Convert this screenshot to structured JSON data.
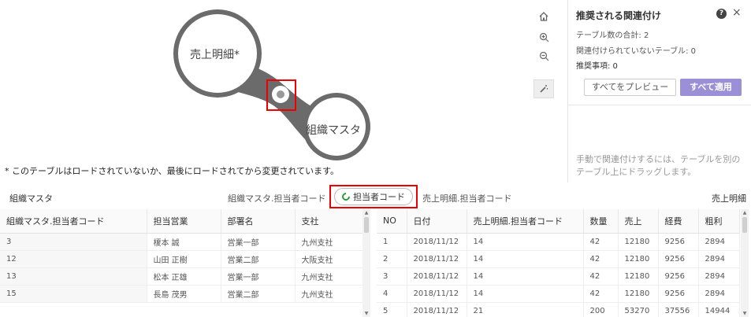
{
  "canvas": {
    "tables": [
      {
        "name": "売上明細*"
      },
      {
        "name": "組織マスタ"
      }
    ],
    "note": "* このテーブルはロードされていないか、最後にロードされてから変更されています。",
    "tools": [
      "home-icon",
      "zoom-in-icon",
      "zoom-out-icon",
      "magic-wand-icon"
    ]
  },
  "panel": {
    "title": "推奨される関連付け",
    "stats": {
      "total": "テーブル数の合計: 2",
      "unlinked": "関連付けられていないテーブル: 0",
      "recommended": "推奨事項: 0"
    },
    "preview_all": "すべてをプレビュー",
    "apply_all": "すべて適用",
    "hint": "手動で関連付けするには、テーブルを別のテーブル上にドラッグします。"
  },
  "join": {
    "left_table": "組織マスタ",
    "left_field": "組織マスタ.担当者コード",
    "key": "担当者コード",
    "right_field": "売上明細.担当者コード",
    "right_table": "売上明細",
    "key_icon_color": "#2a9c3a"
  },
  "left_table": {
    "headers": [
      "組織マスタ.担当者コード",
      "担当営業",
      "部署名",
      "支社"
    ],
    "rows": [
      [
        "3",
        "榎本 誠",
        "営業一部",
        "九州支社"
      ],
      [
        "12",
        "山田 正樹",
        "営業二部",
        "大阪支社"
      ],
      [
        "13",
        "松本 正雄",
        "営業一部",
        "九州支社"
      ],
      [
        "15",
        "長島 茂男",
        "営業二部",
        "九州支社"
      ]
    ]
  },
  "right_table": {
    "headers": [
      "NO",
      "日付",
      "売上明細.担当者コード",
      "数量",
      "売上",
      "経費",
      "粗利"
    ],
    "rows": [
      [
        "1",
        "2018/11/12",
        "14",
        "42",
        "12180",
        "9256",
        "2894"
      ],
      [
        "2",
        "2018/11/12",
        "14",
        "42",
        "12180",
        "9256",
        "2894"
      ],
      [
        "3",
        "2018/11/12",
        "14",
        "42",
        "12180",
        "9256",
        "2894"
      ],
      [
        "4",
        "2018/11/12",
        "14",
        "42",
        "12180",
        "9256",
        "2894"
      ],
      [
        "5",
        "2018/11/12",
        "21",
        "200",
        "53270",
        "37556",
        "14944"
      ]
    ]
  },
  "colors": {
    "accent_button": "#9b8fd6",
    "bubble": "#6b6b6b",
    "highlight": "#e00000"
  }
}
